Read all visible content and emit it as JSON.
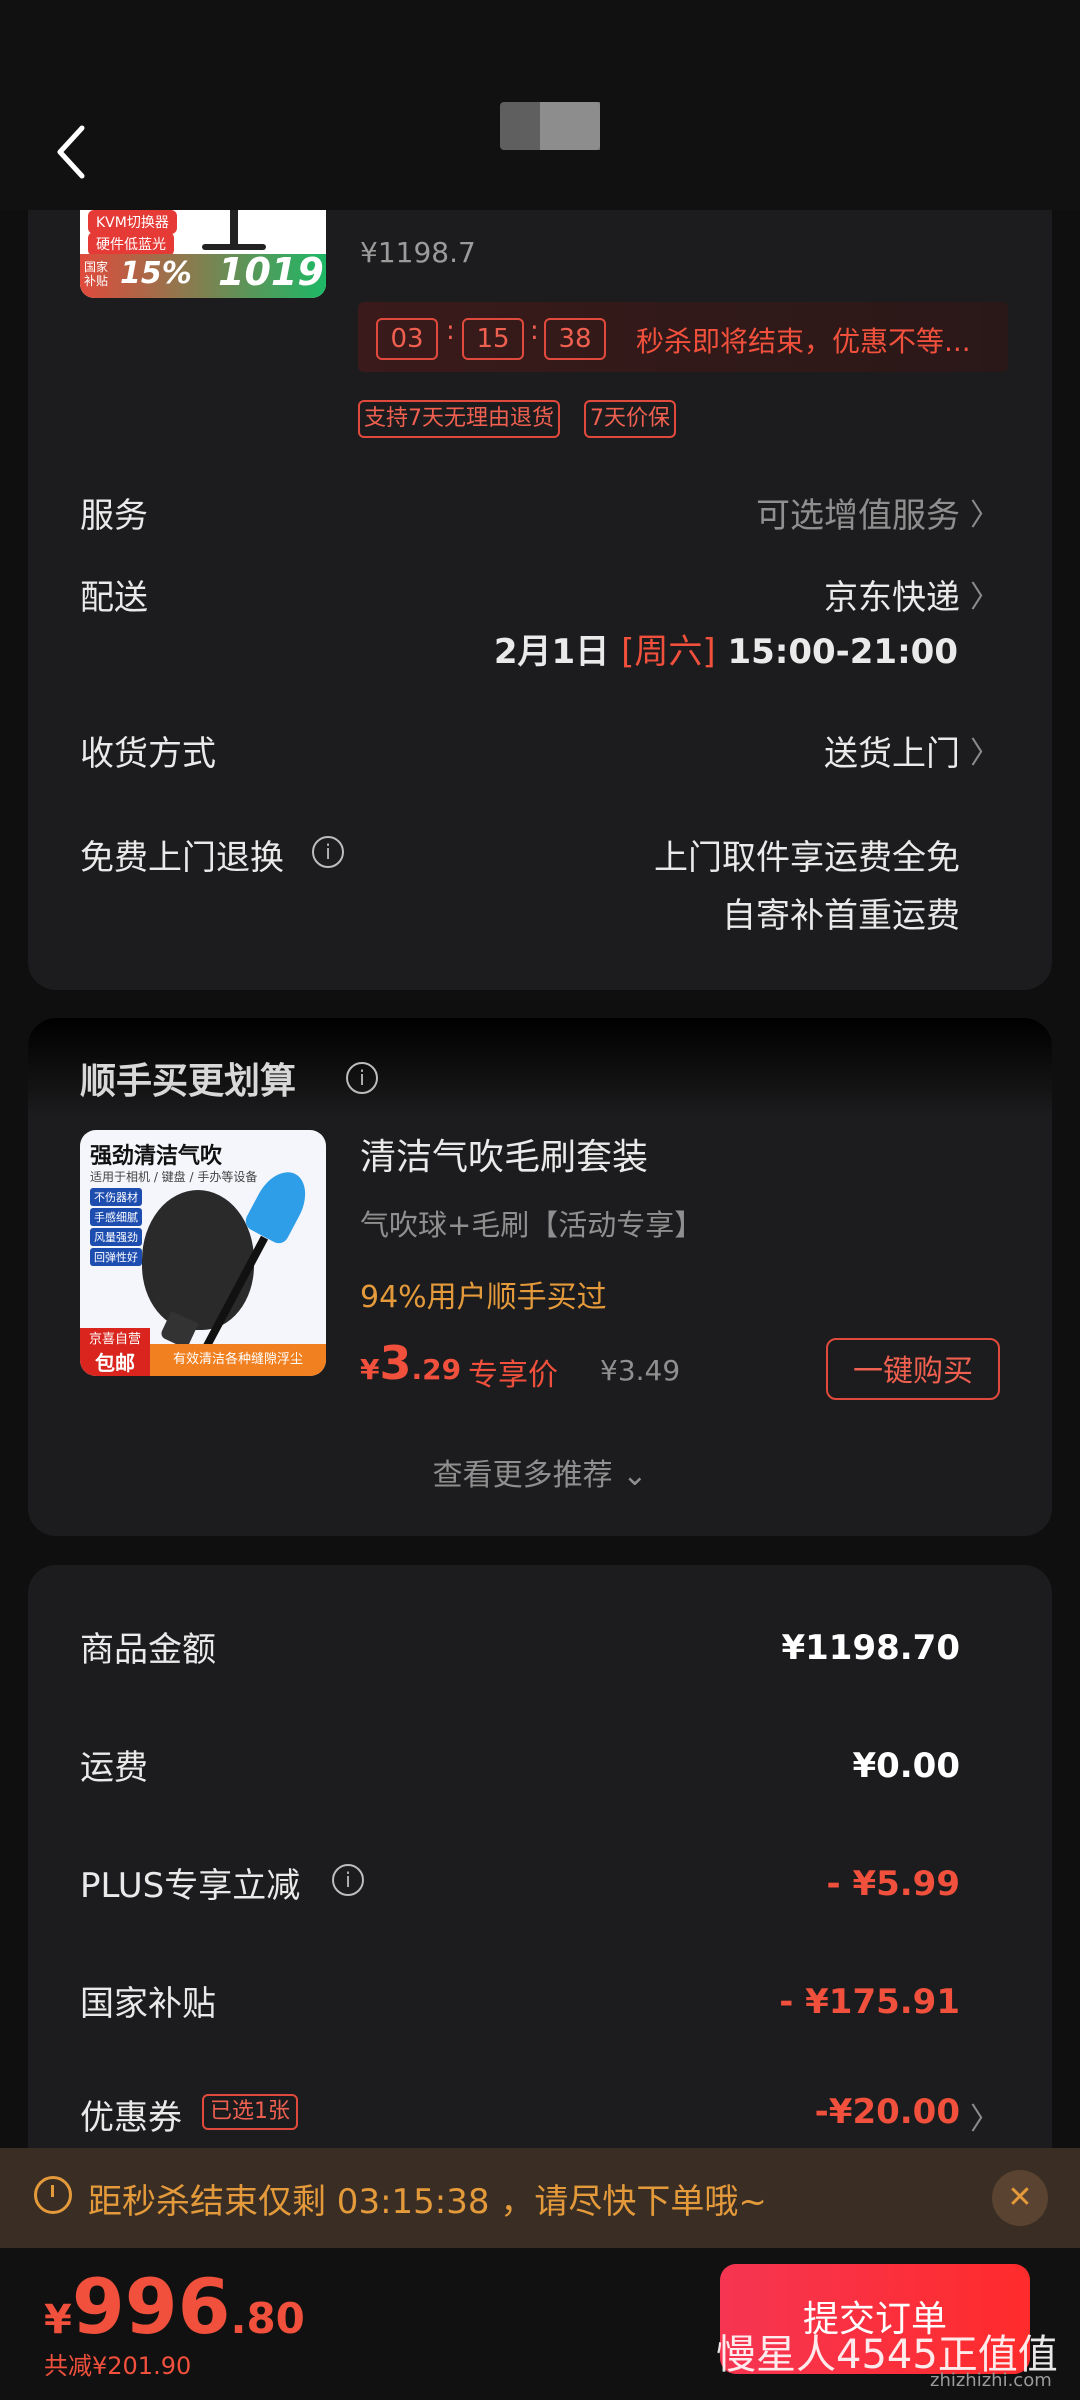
{
  "header": {
    "back_icon": "chevron-left-icon"
  },
  "product": {
    "thumb_tags": [
      "KVM切换器",
      "硬件低蓝光"
    ],
    "thumb_promo_pre": "国家补贴",
    "thumb_percent": "15%",
    "thumb_price": "1019",
    "original_price": "¥1198.7",
    "countdown": [
      "03",
      "15",
      "38"
    ],
    "seckill_text": "秒杀即将结束，优惠不等...",
    "tags": [
      "支持7天无理由退货",
      "7天价保"
    ]
  },
  "service": {
    "label": "服务",
    "value": "可选增值服务"
  },
  "delivery": {
    "label": "配送",
    "value": "京东快递",
    "date": "2月1日",
    "weekday": "[周六]",
    "time": "15:00-21:00"
  },
  "receive": {
    "label": "收货方式",
    "value": "送货上门"
  },
  "return_service": {
    "label": "免费上门退换",
    "line1": "上门取件享运费全免",
    "line2": "自寄补首重运费"
  },
  "addon": {
    "section_title": "顺手买更划算",
    "thumb_title": "强劲清洁气吹",
    "thumb_sub": "适用于相机 / 键盘 / 手办等设备",
    "thumb_features": [
      "不伤器材",
      "手感细腻",
      "风量强劲",
      "回弹性好"
    ],
    "thumb_jd": "京喜自营",
    "thumb_free": "包邮",
    "thumb_bar": "有效清洁各种缝隙浮尘",
    "name": "清洁气吹毛刷套装",
    "subtitle": "气吹球+毛刷【活动专享】",
    "bought": "94%用户顺手买过",
    "price_cur": "¥",
    "price_int": "3",
    "price_dec": ".29",
    "price_label": "专享价",
    "old_price": "¥3.49",
    "buy_label": "一键购买",
    "more_label": "查看更多推荐 ⌄"
  },
  "summary": {
    "goods_label": "商品金额",
    "goods_value": "¥1198.70",
    "shipping_label": "运费",
    "shipping_value": "¥0.00",
    "plus_label": "PLUS专享立减",
    "plus_value": "- ¥5.99",
    "subsidy_label": "国家补贴",
    "subsidy_value": "- ¥175.91",
    "coupon_label": "优惠券",
    "coupon_tag": "已选1张",
    "coupon_value": "-¥20.00"
  },
  "banner": {
    "text": "距秒杀结束仅剩 03:15:38 ，请尽快下单哦~",
    "close": "✕"
  },
  "bottom": {
    "cur": "¥",
    "int": "996",
    "dec": ".80",
    "saved": "共减¥201.90",
    "submit_label": "提交订单"
  },
  "watermark": {
    "text": "慢星人4545正值值",
    "site": "zhizhizhi.com"
  },
  "colors": {
    "accent": "#f0503c",
    "orange": "#e49a3b",
    "background": "#0f0f10",
    "card": "#1c1c1e"
  }
}
